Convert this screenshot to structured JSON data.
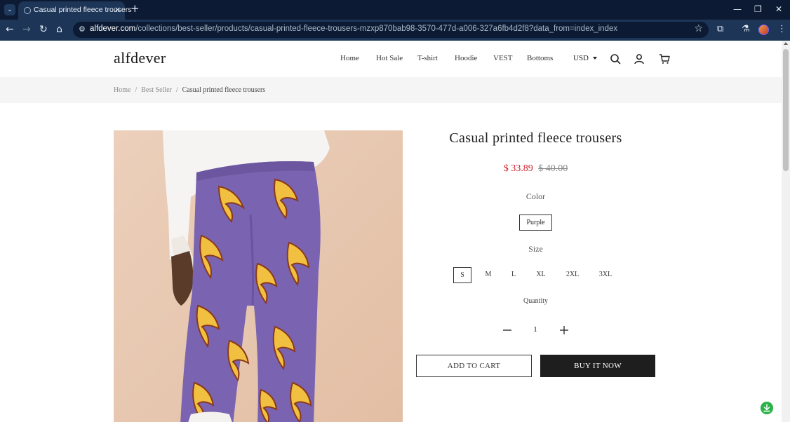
{
  "browser": {
    "tab_title": "Casual printed fleece trousers",
    "tab_close_icon": "×",
    "new_tab_icon": "+",
    "url_host": "alfdever.com",
    "url_path": "/collections/best-seller/products/casual-printed-fleece-trousers-mzxp870bab98-3570-477d-a006-327a6fb4d2f8?data_from=index_index"
  },
  "header": {
    "logo": "alfdever",
    "nav": [
      "Home",
      "Hot Sale",
      "T-shirt",
      "Hoodie",
      "VEST",
      "Bottoms"
    ],
    "currency": "USD"
  },
  "breadcrumb": {
    "items": [
      "Home",
      "Best Seller"
    ],
    "current": "Casual printed fleece trousers",
    "separator": "/"
  },
  "product": {
    "title": "Casual printed fleece trousers",
    "price_sale": "$ 33.89",
    "price_original": "$ 40.00",
    "color_label": "Color",
    "color_value": "Purple",
    "size_label": "Size",
    "sizes": [
      "S",
      "M",
      "L",
      "XL",
      "2XL",
      "3XL"
    ],
    "selected_size": "S",
    "quantity_label": "Quantity",
    "quantity": "1",
    "add_to_cart": "ADD TO CART",
    "buy_now": "BUY IT NOW"
  },
  "colors": {
    "chrome_dark": "#0c1b33",
    "chrome_toolbar": "#1d3557",
    "sale_price": "#d0212e",
    "buy_button": "#1e1e1e",
    "trousers": "#7a63b0",
    "badge": "#2bb34a"
  }
}
